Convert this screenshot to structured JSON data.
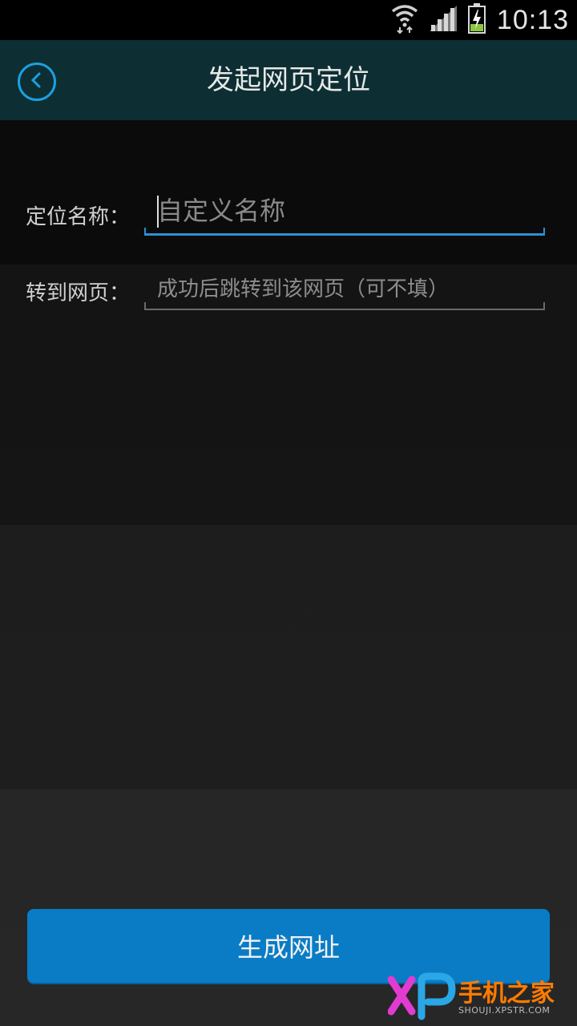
{
  "status_bar": {
    "time": "10:13",
    "icons": [
      "wifi-icon",
      "signal-icon",
      "battery-charging-icon"
    ]
  },
  "header": {
    "title": "发起网页定位",
    "back_icon": "back-chevron-icon",
    "accent_color": "#1d9fe0"
  },
  "form": {
    "name": {
      "label": "定位名称：",
      "placeholder": "自定义名称",
      "value": ""
    },
    "url": {
      "label": "转到网页：",
      "placeholder": "成功后跳转到该网页（可不填）",
      "value": ""
    }
  },
  "actions": {
    "generate_label": "生成网址",
    "button_color": "#0a7cc6"
  },
  "watermark": {
    "brand": "手机之家",
    "sub": "SHOUJI.XPSTR.COM"
  }
}
